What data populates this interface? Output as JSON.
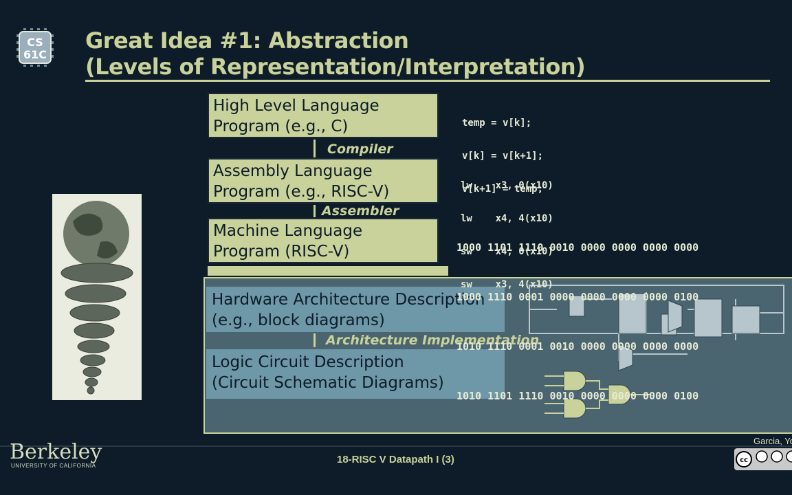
{
  "logo": {
    "line1": "CS",
    "line2": "61C"
  },
  "title": {
    "line1": "Great Idea #1: Abstraction",
    "line2": "(Levels of Representation/Interpretation)"
  },
  "levels": [
    {
      "line1": "High Level Language",
      "line2": "Program (e.g., C)"
    },
    {
      "line1": "Assembly  Language",
      "line2": "Program (e.g., RISC-V)"
    },
    {
      "line1": "Machine  Language",
      "line2": "Program (RISC-V)"
    },
    {
      "line1": "Hardware Architecture Description",
      "line2": "(e.g., block diagrams)"
    },
    {
      "line1": "Logic Circuit Description",
      "line2": "(Circuit Schematic Diagrams)"
    }
  ],
  "transitions": [
    "Compiler",
    "Assembler",
    "Architecture Implementation"
  ],
  "c_code": [
    "temp = v[k];",
    "v[k] = v[k+1];",
    "v[k+1] = temp;"
  ],
  "asm_code": [
    "lw    x3, 0(x10)",
    "lw    x4, 4(x10)",
    "sw    x4, 0(x10)",
    "sw    x3, 4(x10)"
  ],
  "machine_code": [
    "1000 1101 1110 0010 0000 0000 0000 0000",
    "1000 1110 0001 0000 0000 0000 0000 0100",
    "1010 1110 0001 0010 0000 0000 0000 0000",
    "1010 1101 1110 0010 0000 0000 0000 0100"
  ],
  "footer": {
    "university": "Berkeley",
    "university_sub": "UNIVERSITY OF CALIFORNIA",
    "lecture": "18-RISC V Datapath I (3)",
    "author": "Garcia, Yo"
  },
  "colors": {
    "background": "#0d1c28",
    "accent": "#c9d29a",
    "panel": "#6e97a8"
  },
  "icons": [
    "chip-logo",
    "turtle-stack-image",
    "cc-license-icon"
  ]
}
